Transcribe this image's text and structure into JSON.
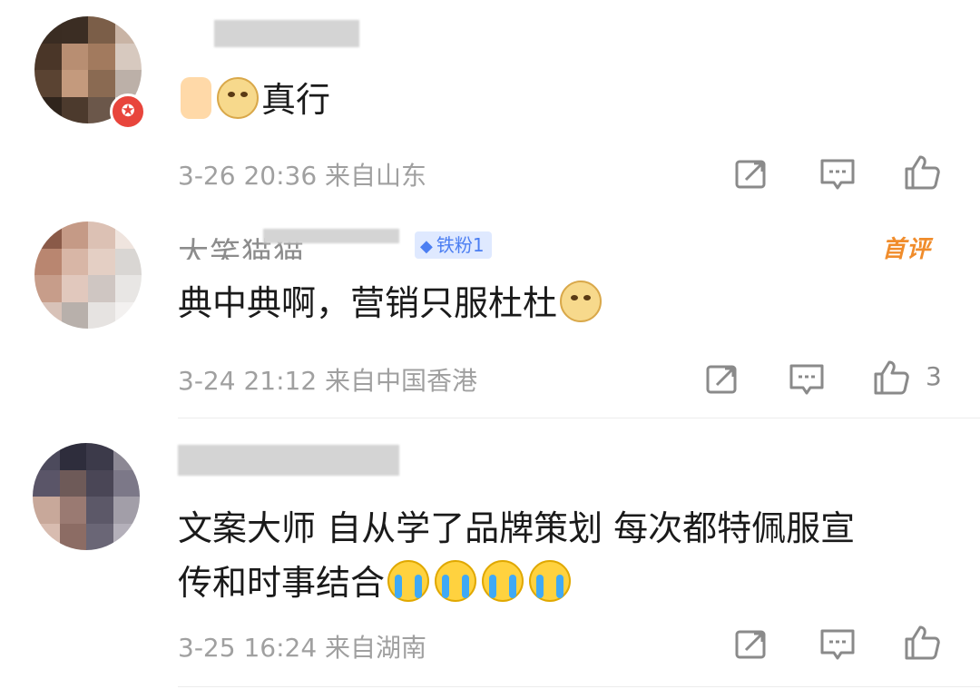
{
  "comments": [
    {
      "content": "真行",
      "time": "3-26 20:36",
      "location": "来自山东",
      "like_count": ""
    },
    {
      "username_visible": "大笑猫猫_...",
      "fan_badge": "铁粉1",
      "first_tag": "首评",
      "content": "典中典啊，营销只服杜杜",
      "time": "3-24 21:12",
      "location": "来自中国香港",
      "like_count": "3"
    },
    {
      "content_line1": "文案大师 自从学了品牌策划 每次都特佩服宣",
      "content_line2": "传和时事结合",
      "time": "3-25 16:24",
      "location": "来自湖南",
      "like_count": ""
    }
  ],
  "icons": [
    "share-icon",
    "comment-icon",
    "like-icon",
    "thumbs-up-emoji",
    "doge-emoji",
    "crying-emoji",
    "diamond-icon"
  ],
  "colors": {
    "accent_orange": "#f08c2b",
    "badge_blue": "#4b7ef2",
    "meta_gray": "#a0a0a0",
    "vip_red": "#e8453c"
  }
}
